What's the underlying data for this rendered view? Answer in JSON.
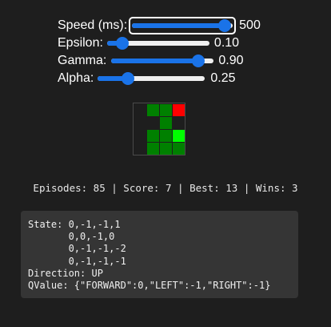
{
  "controls": {
    "speed": {
      "label": "Speed (ms):",
      "value": "500",
      "fraction": 0.98
    },
    "epsilon": {
      "label": "Epsilon:",
      "value": "0.10",
      "fraction": 0.1
    },
    "gamma": {
      "label": "Gamma:",
      "value": "0.90",
      "fraction": 0.9
    },
    "alpha": {
      "label": "Alpha:",
      "value": "0.25",
      "fraction": 0.25
    }
  },
  "board": {
    "cols": 4,
    "rows": 4,
    "colors": {
      "snake": "#008000",
      "head": "#00ff00",
      "food": "#ff0000",
      "empty": "#1e1e1e"
    },
    "cells": [
      [
        "empty",
        "snake",
        "snake",
        "food"
      ],
      [
        "empty",
        "empty",
        "snake",
        "empty"
      ],
      [
        "empty",
        "snake",
        "snake",
        "head"
      ],
      [
        "empty",
        "snake",
        "snake",
        "snake"
      ]
    ]
  },
  "stats": "Episodes: 85 | Score: 7 | Best: 13 | Wins: 3",
  "info": {
    "lines": [
      "State: 0,-1,-1,1",
      "       0,0,-1,0",
      "       0,-1,-1,-2",
      "       0,-1,-1,-1",
      "Direction: UP",
      "QValue: {\"FORWARD\":0,\"LEFT\":-1,\"RIGHT\":-1}"
    ]
  }
}
